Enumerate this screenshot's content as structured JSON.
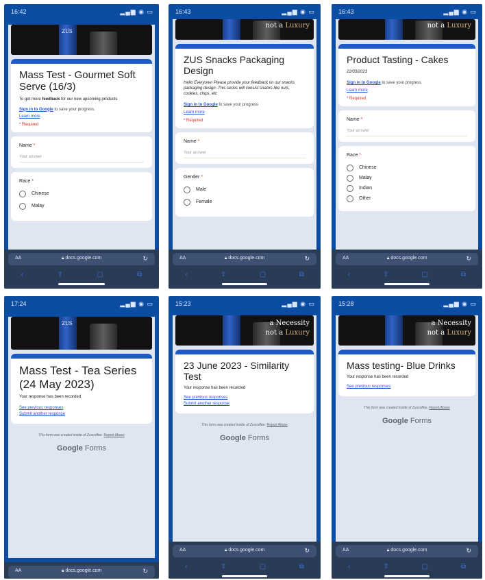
{
  "phones": [
    {
      "time": "16:42",
      "form_title": "Mass Test - Gourmet Soft Serve (16/3)",
      "description_prefix": "To get more ",
      "description_bold": "feedback",
      "description_suffix": " for our new upcoming products",
      "signin_link": "Sign in to Google",
      "signin_rest": " to save your progress.",
      "learn_more": "Learn more",
      "required": "* Required",
      "name_label": "Name",
      "answer_placeholder": "Your answer",
      "race_label": "Race",
      "options": [
        "Chinese",
        "Malay"
      ],
      "url": "docs.google.com",
      "aa": "AA"
    },
    {
      "time": "16:43",
      "banner_line2_a": "not a ",
      "banner_line2_b": "Luxury",
      "form_title": "ZUS Snacks Packaging Design",
      "description": "Hello Everyone! Please provide your feedback on our snacks packaging design. This series will consist snacks like nuts, cookies, chips, etc",
      "signin_link": "Sign in to Google",
      "signin_rest": " to save your progress",
      "learn_more": "Learn more",
      "required": "* Required",
      "name_label": "Name",
      "answer_placeholder": "Your answer",
      "gender_label": "Gender",
      "options": [
        "Male",
        "Female"
      ],
      "url": "docs.google.com",
      "aa": "AA"
    },
    {
      "time": "16:43",
      "banner_line2_a": "not a ",
      "banner_line2_b": "Luxury",
      "form_title": "Product Tasting - Cakes",
      "date": "22/03/2023",
      "signin_link": "Sign in to Google",
      "signin_rest": " to save your progress",
      "learn_more": "Learn more",
      "required": "* Required",
      "name_label": "Name",
      "answer_placeholder": "Your answer",
      "race_label": "Race",
      "options": [
        "Chinese",
        "Malay",
        "Indian",
        "Other"
      ],
      "url": "docs.google.com",
      "aa": "AA"
    },
    {
      "time": "17:24",
      "form_title": "Mass Test - Tea Series (24 May 2023)",
      "recorded": "Your response has been recorded",
      "see_previous": "See previous responses",
      "submit_another": "Submit another response",
      "footer_note": "This form was created inside of Zuscoffee.",
      "report": "Report Abuse",
      "google": "Google",
      "forms": "Forms",
      "url": "docs.google.com",
      "aa": "AA"
    },
    {
      "time": "15:23",
      "banner_line1": "a Necessity",
      "banner_line2_a": "not a ",
      "banner_line2_b": "Luxury",
      "form_title": "23 June 2023 - Similarity Test",
      "recorded": "Your response has been recorded",
      "see_previous": "See previous responses",
      "submit_another": "Submit another response",
      "footer_note": "This form was created inside of Zuscoffee.",
      "report": "Report Abuse",
      "google": "Google",
      "forms": "Forms",
      "url": "docs.google.com",
      "aa": "AA"
    },
    {
      "time": "15:28",
      "banner_line1": "a Necessity",
      "banner_line2_a": "not a ",
      "banner_line2_b": "Luxury",
      "form_title": "Mass testing- Blue Drinks",
      "recorded": "Your response has been recorded",
      "see_previous": "See previous responses",
      "footer_note": "This form was created inside of Zuscoffee.",
      "report": "Report Abuse",
      "google": "Google",
      "forms": "Forms",
      "url": "docs.google.com",
      "aa": "AA"
    }
  ],
  "banner_logo": "ZUS",
  "colors": {
    "accent": "#1c5bc7",
    "required": "#d93025",
    "link": "#1a57c9",
    "background_blue": "#0a4da2"
  },
  "icons": [
    "signal-icon",
    "wifi-icon",
    "battery-icon",
    "lock-icon",
    "reload-icon",
    "back-icon",
    "share-icon",
    "bookmarks-icon",
    "tabs-icon"
  ]
}
